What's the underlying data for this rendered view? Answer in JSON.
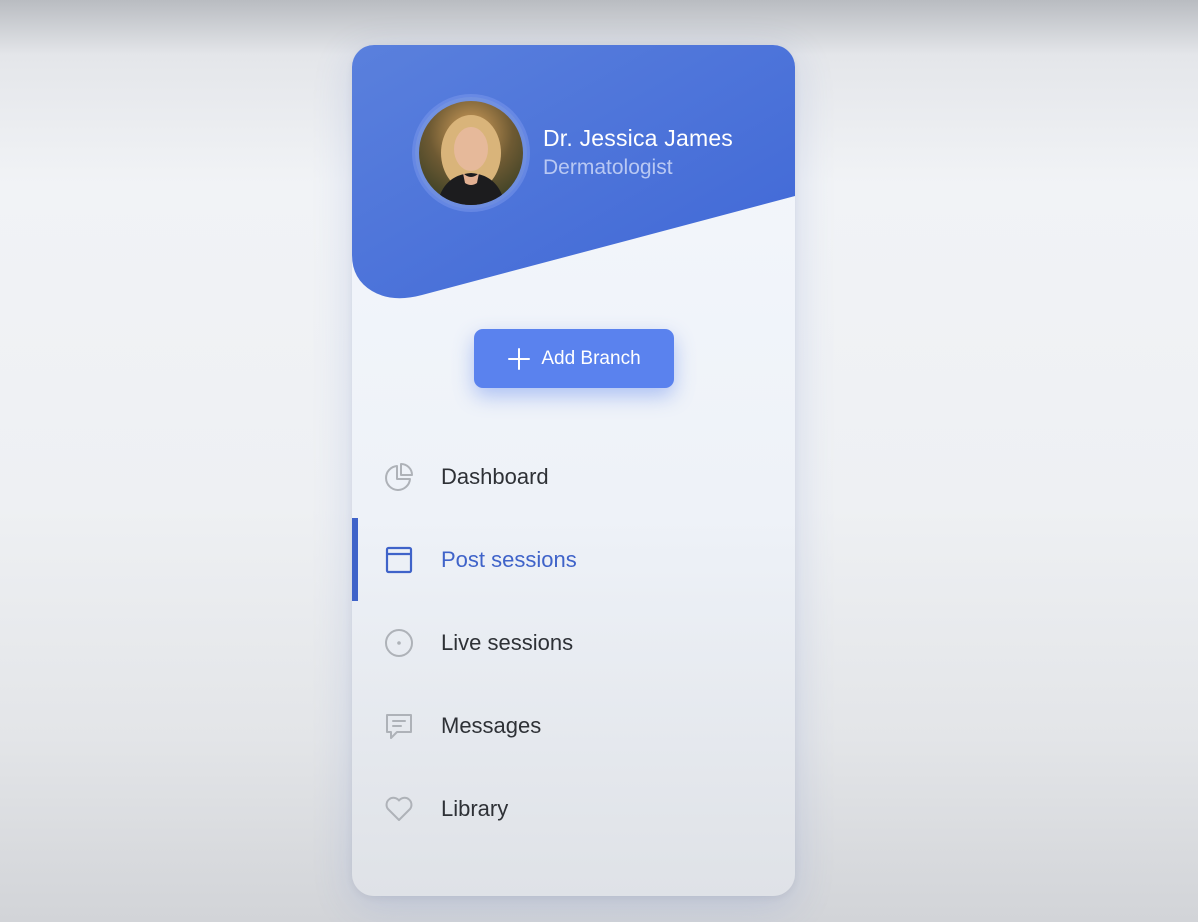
{
  "profile": {
    "name": "Dr. Jessica James",
    "role": "Dermatologist"
  },
  "actions": {
    "add_branch_label": "Add Branch"
  },
  "nav": {
    "active_index": 1,
    "items": [
      {
        "label": "Dashboard",
        "icon": "pie-chart-icon"
      },
      {
        "label": "Post sessions",
        "icon": "browser-window-icon"
      },
      {
        "label": "Live sessions",
        "icon": "record-circle-icon"
      },
      {
        "label": "Messages",
        "icon": "message-icon"
      },
      {
        "label": "Library",
        "icon": "heart-icon"
      }
    ]
  },
  "colors": {
    "header_gradient_start": "#5a80dd",
    "header_gradient_end": "#3f67d6",
    "accent": "#3f63c9",
    "button": "#5a82ee",
    "icon_muted": "#aeb2b8"
  }
}
